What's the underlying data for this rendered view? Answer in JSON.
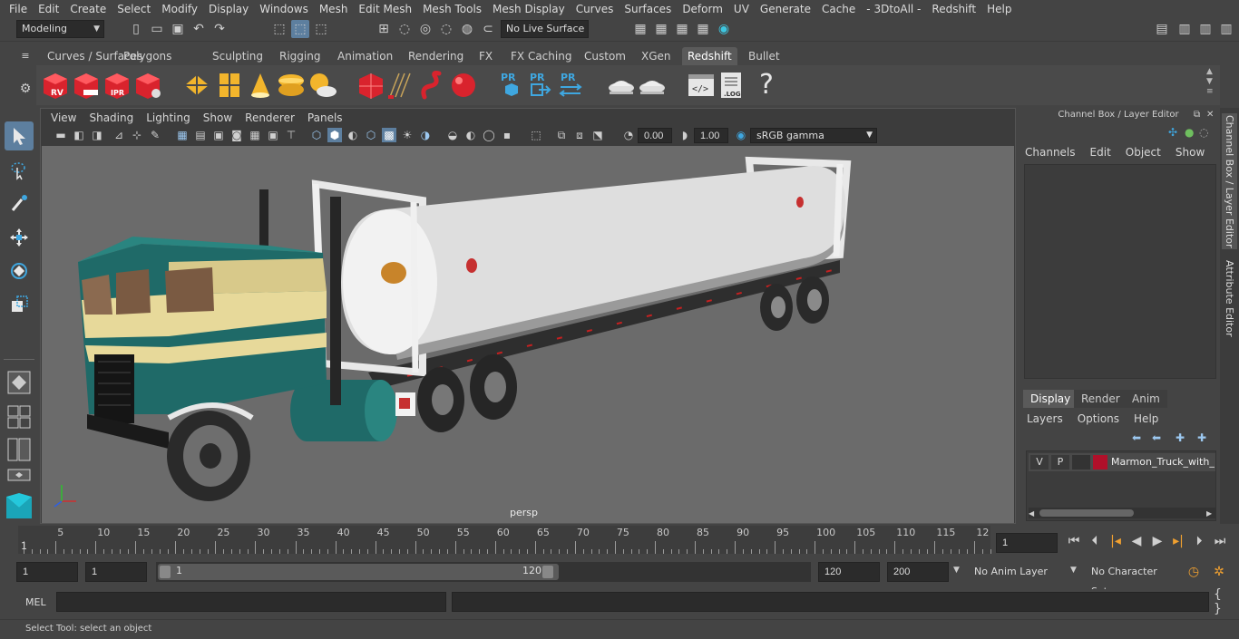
{
  "menubar": {
    "items": [
      "File",
      "Edit",
      "Create",
      "Select",
      "Modify",
      "Display",
      "Windows",
      "Mesh",
      "Edit Mesh",
      "Mesh Tools",
      "Mesh Display",
      "Curves",
      "Surfaces",
      "Deform",
      "UV",
      "Generate",
      "Cache",
      "- 3DtoAll -",
      "Redshift",
      "Help"
    ]
  },
  "statusline": {
    "mode": "Modeling",
    "live_surface": "No Live Surface"
  },
  "shelf": {
    "tabs": [
      "Curves / Surfaces",
      "Polygons",
      "Sculpting",
      "Rigging",
      "Animation",
      "Rendering",
      "FX",
      "FX Caching",
      "Custom",
      "XGen",
      "Redshift",
      "Bullet"
    ],
    "active_tab": "Redshift",
    "icon_labels": {
      "rv": "RV",
      "ipr": "IPR",
      "pr": "PR",
      "log": ".LOG"
    }
  },
  "viewport": {
    "menu": [
      "View",
      "Shading",
      "Lighting",
      "Show",
      "Renderer",
      "Panels"
    ],
    "exposure": "0.00",
    "gamma": "1.00",
    "color_space": "sRGB gamma",
    "camera": "persp"
  },
  "channelbox": {
    "title": "Channel Box / Layer Editor",
    "menu": [
      "Channels",
      "Edit",
      "Object",
      "Show"
    ]
  },
  "layers": {
    "tabs": [
      "Display",
      "Render",
      "Anim"
    ],
    "active_tab": "Display",
    "menu": [
      "Layers",
      "Options",
      "Help"
    ],
    "rows": [
      {
        "v": "V",
        "p": "P",
        "name": "Marmon_Truck_with_L",
        "color": "#b0102a"
      }
    ]
  },
  "sidetabs": {
    "channel": "Channel Box / Layer Editor",
    "attr": "Attribute Editor"
  },
  "timeline": {
    "ticks": [
      "5",
      "10",
      "15",
      "20",
      "25",
      "30",
      "35",
      "40",
      "45",
      "50",
      "55",
      "60",
      "65",
      "70",
      "75",
      "80",
      "85",
      "90",
      "95",
      "100",
      "105",
      "110",
      "115",
      "12"
    ],
    "start_label": "1",
    "current_frame": "1"
  },
  "range": {
    "start": "1",
    "start2": "1",
    "slider_start": "1",
    "slider_end": "120",
    "end": "120",
    "end2": "200",
    "anim_layer": "No Anim Layer",
    "character_set": "No Character Set"
  },
  "cmdline": {
    "label": "MEL"
  },
  "helpline": {
    "text": "Select Tool: select an object"
  }
}
